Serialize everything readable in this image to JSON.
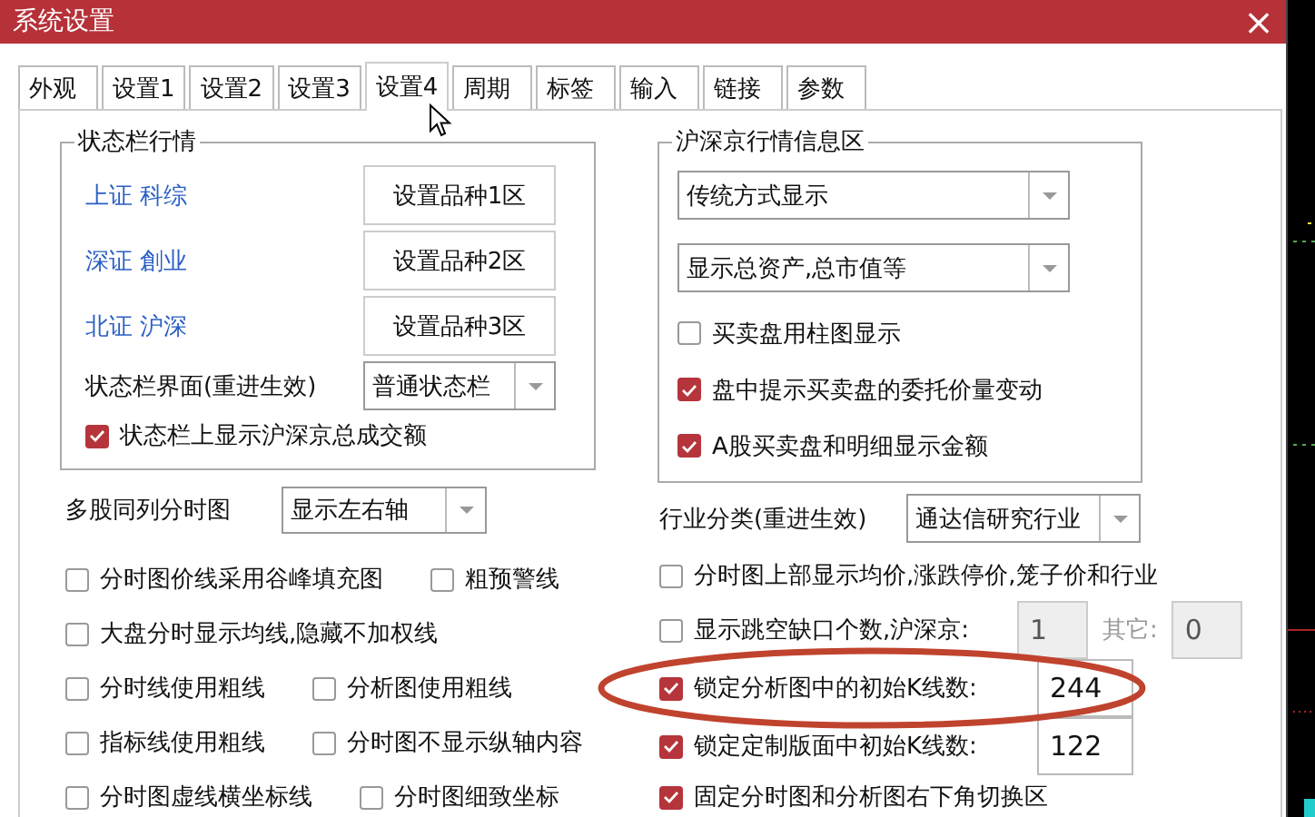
{
  "window": {
    "title": "系统设置",
    "close": "×"
  },
  "tabs": [
    {
      "label": "外观",
      "selected": false
    },
    {
      "label": "设置1",
      "selected": false
    },
    {
      "label": "设置2",
      "selected": false
    },
    {
      "label": "设置3",
      "selected": false
    },
    {
      "label": "设置4",
      "selected": true
    },
    {
      "label": "周期",
      "selected": false
    },
    {
      "label": "标签",
      "selected": false
    },
    {
      "label": "输入",
      "selected": false
    },
    {
      "label": "链接",
      "selected": false
    },
    {
      "label": "参数",
      "selected": false
    }
  ],
  "status_group": {
    "title": "状态栏行情",
    "rows": [
      {
        "label": "上证 科综",
        "button": "设置品种1区"
      },
      {
        "label": "深证 創业",
        "button": "设置品种2区"
      },
      {
        "label": "北证 沪深",
        "button": "设置品种3区"
      }
    ],
    "interface": {
      "label": "状态栏界面(重进生效)",
      "value": "普通状态栏"
    },
    "checkbox": {
      "label": "状态栏上显示沪深京总成交额",
      "checked": true
    }
  },
  "multi_chart": {
    "label": "多股同列分时图",
    "value": "显示左右轴"
  },
  "left_options": [
    [
      {
        "label": "分时图价线采用谷峰填充图",
        "checked": false
      },
      {
        "label": "粗预警线",
        "checked": false
      }
    ],
    [
      {
        "label": "大盘分时显示均线,隐藏不加权线",
        "checked": false
      }
    ],
    [
      {
        "label": "分时线使用粗线",
        "checked": false
      },
      {
        "label": "分析图使用粗线",
        "checked": false
      }
    ],
    [
      {
        "label": "指标线使用粗线",
        "checked": false
      },
      {
        "label": "分时图不显示纵轴内容",
        "checked": false
      }
    ],
    [
      {
        "label": "分时图虚线横坐标线",
        "checked": false
      },
      {
        "label": "分时图细致坐标",
        "checked": false
      }
    ]
  ],
  "info_group": {
    "title": "沪深京行情信息区",
    "dropdowns": [
      "传统方式显示",
      "显示总资产,总市值等"
    ],
    "checkboxes": [
      {
        "label": "买卖盘用柱图显示",
        "checked": false
      },
      {
        "label": "盘中提示买卖盘的委托价量变动",
        "checked": true
      },
      {
        "label": "A股买卖盘和明细显示金额",
        "checked": true
      }
    ]
  },
  "industry": {
    "label": "行业分类(重进生效)",
    "value": "通达信研究行业"
  },
  "right_options": [
    {
      "kind": "check",
      "label": "分时图上部显示均价,涨跌停价,笼子价和行业",
      "checked": false
    },
    {
      "kind": "gap",
      "label": "显示跳空缺口个数,沪深京:",
      "checked": false,
      "value": "1",
      "other_label": "其它:",
      "other_value": "0",
      "disabled": true
    },
    {
      "kind": "count",
      "label": "锁定分析图中的初始K线数:",
      "checked": true,
      "value": "244"
    },
    {
      "kind": "count",
      "label": "锁定定制版面中初始K线数:",
      "checked": true,
      "value": "122"
    },
    {
      "kind": "check",
      "label": "固定分时图和分析图右下角切换区",
      "checked": true
    }
  ]
}
